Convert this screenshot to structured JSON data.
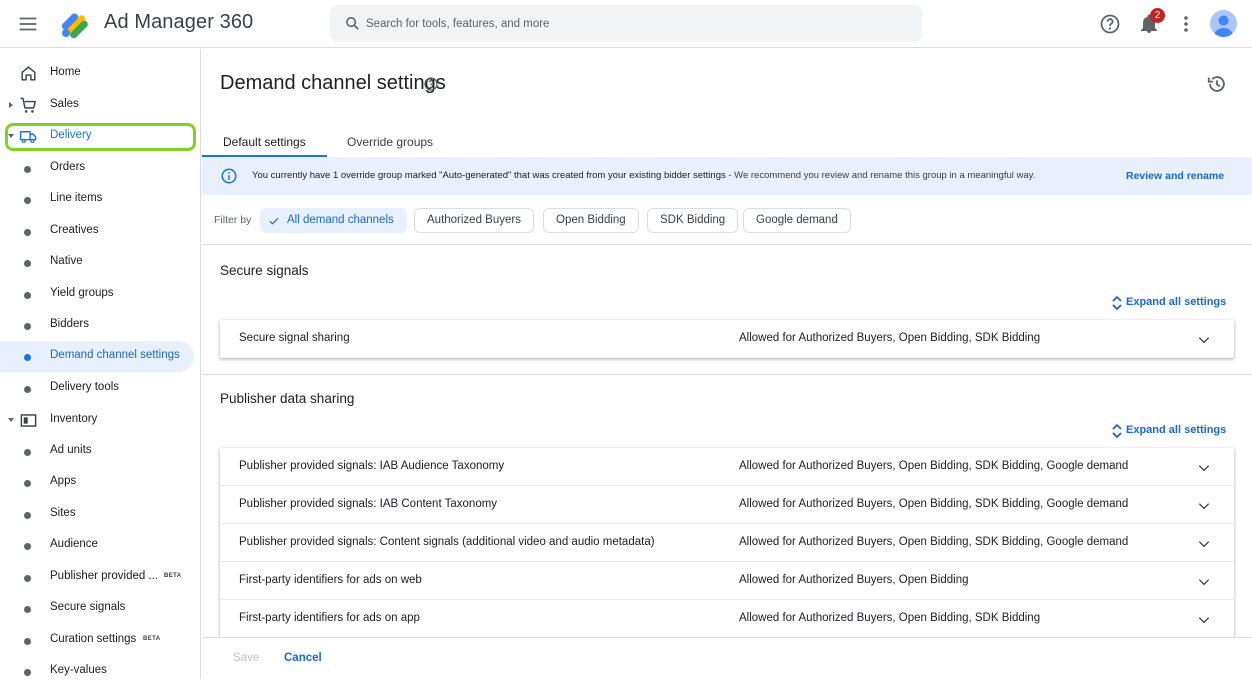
{
  "header": {
    "app_title": "Ad Manager 360",
    "search_placeholder": "Search for tools, features, and more",
    "notification_count": "2"
  },
  "sidebar": {
    "items": [
      {
        "label": "Home",
        "icon": "home-icon"
      },
      {
        "label": "Sales",
        "icon": "cart-icon"
      },
      {
        "label": "Delivery",
        "icon": "truck-icon"
      },
      {
        "label": "Orders"
      },
      {
        "label": "Line items"
      },
      {
        "label": "Creatives"
      },
      {
        "label": "Native"
      },
      {
        "label": "Yield groups"
      },
      {
        "label": "Bidders"
      },
      {
        "label": "Demand channel settings"
      },
      {
        "label": "Delivery tools"
      },
      {
        "label": "Inventory",
        "icon": "inventory-icon"
      },
      {
        "label": "Ad units"
      },
      {
        "label": "Apps"
      },
      {
        "label": "Sites"
      },
      {
        "label": "Audience"
      },
      {
        "label": "Publisher provided ...",
        "badge": "BETA"
      },
      {
        "label": "Secure signals"
      },
      {
        "label": "Curation settings",
        "badge": "BETA"
      },
      {
        "label": "Key-values"
      }
    ]
  },
  "page": {
    "title": "Demand channel settings",
    "tabs": [
      "Default settings",
      "Override groups"
    ],
    "info": {
      "message": "You currently have 1 override group marked \"Auto-generated\" that was created from your existing bidder settings",
      "message_rest": " - We recommend you review and rename this group in a meaningful way.",
      "action": "Review and rename"
    },
    "filter": {
      "label": "Filter by",
      "chips": [
        "All demand channels",
        "Authorized Buyers",
        "Open Bidding",
        "SDK Bidding",
        "Google demand"
      ]
    },
    "expand_all": "Expand all settings",
    "sections": [
      {
        "title": "Secure signals",
        "rows": [
          {
            "name": "Secure signal sharing",
            "value": "Allowed for Authorized Buyers, Open Bidding, SDK Bidding"
          }
        ]
      },
      {
        "title": "Publisher data sharing",
        "rows": [
          {
            "name": "Publisher provided signals: IAB Audience Taxonomy",
            "value": "Allowed for Authorized Buyers, Open Bidding, SDK Bidding, Google demand"
          },
          {
            "name": "Publisher provided signals: IAB Content Taxonomy",
            "value": "Allowed for Authorized Buyers, Open Bidding, SDK Bidding, Google demand"
          },
          {
            "name": "Publisher provided signals: Content signals (additional video and audio metadata)",
            "value": "Allowed for Authorized Buyers, Open Bidding, SDK Bidding, Google demand"
          },
          {
            "name": "First-party identifiers for ads on web",
            "value": "Allowed for Authorized Buyers, Open Bidding"
          },
          {
            "name": "First-party identifiers for ads on app",
            "value": "Allowed for Authorized Buyers, Open Bidding, SDK Bidding"
          }
        ]
      }
    ],
    "footer": {
      "save": "Save",
      "cancel": "Cancel"
    }
  },
  "colors": {
    "accent": "#1a73e8",
    "highlight": "#7ed321",
    "info_bg": "#e8f0fe"
  }
}
